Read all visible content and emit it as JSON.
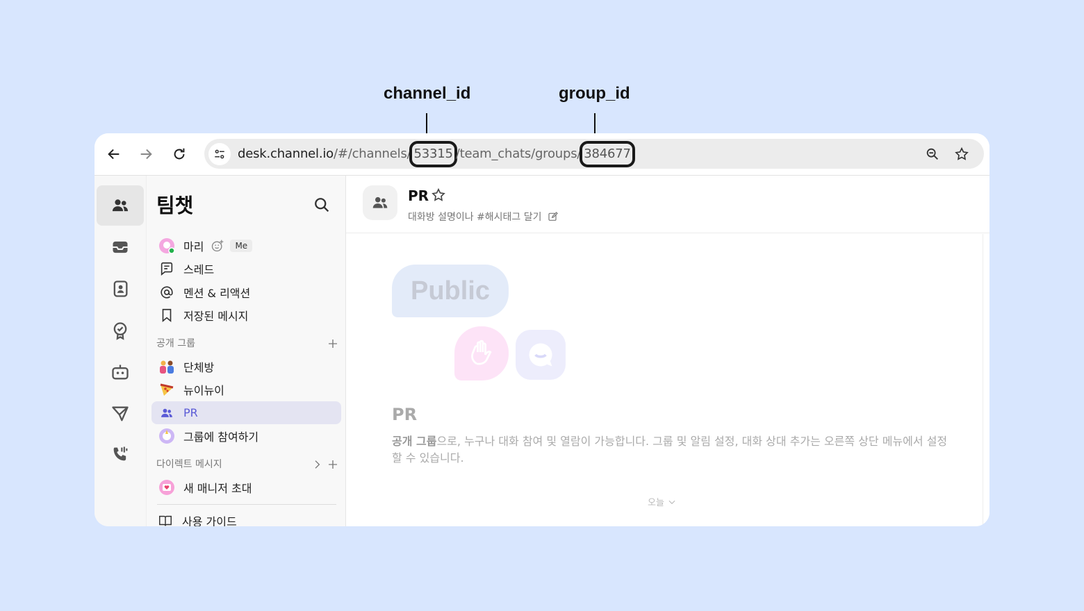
{
  "annotations": {
    "channel_label": "channel_id",
    "group_label": "group_id"
  },
  "browser": {
    "url_host": "desk.channel.io",
    "url_path1": "/#/channels/",
    "channel_id": "53315",
    "url_path2": "/team_chats/groups/",
    "group_id": "384677"
  },
  "rail": {
    "items": [
      "team-chat-icon",
      "inbox-icon",
      "contacts-icon",
      "badge-check-icon",
      "bot-icon",
      "send-icon",
      "phone-call-icon"
    ]
  },
  "sidebar": {
    "title": "팀챗",
    "user": {
      "name": "마리",
      "badge": "Me"
    },
    "nav": [
      {
        "label": "스레드",
        "icon": "thread-icon"
      },
      {
        "label": "멘션 & 리액션",
        "icon": "at-icon"
      },
      {
        "label": "저장된 메시지",
        "icon": "bookmark-icon"
      }
    ],
    "public_section": "공개 그룹",
    "groups": [
      {
        "label": "단체방",
        "icon": "people-emoji-icon"
      },
      {
        "label": "뉴이뉴이",
        "icon": "pizza-emoji-icon"
      },
      {
        "label": "PR",
        "icon": "group-icon"
      },
      {
        "label": "그룹에 참여하기",
        "icon": "unicorn-icon"
      }
    ],
    "dm_section": "다이렉트 메시지",
    "dm_items": [
      {
        "label": "새 매니저 초대",
        "icon": "heart-icon"
      }
    ],
    "guide": "사용 가이드"
  },
  "main": {
    "channel_name": "PR",
    "channel_desc": "대화방 설명이나 #해시태그 달기",
    "public_badge": "Public",
    "intro_title": "PR",
    "intro_bold": "공개 그룹",
    "intro_text": "으로, 누구나 대화 참여 및 열람이 가능합니다. 그룹 및 알림 설정, 대화 상대 추가는 오른쪽 상단 메뉴에서 설정할 수 있습니다.",
    "today_label": "오늘"
  },
  "colors": {
    "background": "#d8e6fe",
    "active_item_bg": "#e4e4f2",
    "active_item_text": "#5b5bd6"
  }
}
